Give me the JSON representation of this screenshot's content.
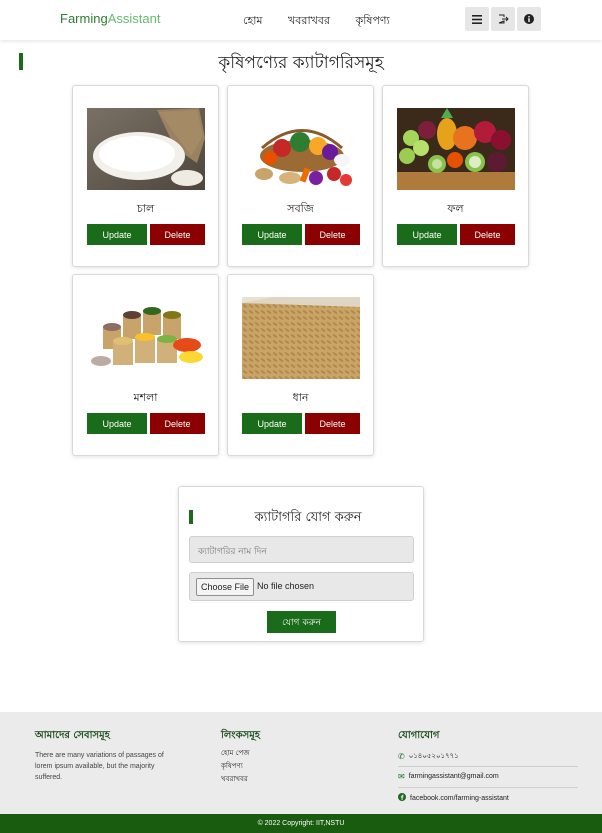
{
  "brand": {
    "part1": "Farming",
    "part2": "Assistant"
  },
  "nav": {
    "links": [
      "হোম",
      "খবরাখবর",
      "কৃষিপণ্য"
    ]
  },
  "nav_icons": [
    "menu-icon",
    "logout-icon",
    "info-icon"
  ],
  "section": {
    "title": "কৃষিপণ্যের ক্যাটাগরিসমূহ"
  },
  "categories": [
    {
      "name": "চাল",
      "image": "rice-image",
      "update_label": "Update",
      "delete_label": "Delete"
    },
    {
      "name": "সবজি",
      "image": "vegetables-image",
      "update_label": "Update",
      "delete_label": "Delete"
    },
    {
      "name": "ফল",
      "image": "fruits-image",
      "update_label": "Update",
      "delete_label": "Delete"
    },
    {
      "name": "মশলা",
      "image": "spices-image",
      "update_label": "Update",
      "delete_label": "Delete"
    },
    {
      "name": "ধান",
      "image": "paddy-image",
      "update_label": "Update",
      "delete_label": "Delete"
    }
  ],
  "add_form": {
    "title": "ক্যাটাগরি যোগ করুন",
    "input_placeholder": "ক্যাটাগরির নাম দিন",
    "file_button": "Choose File",
    "file_status": "No file chosen",
    "submit_label": "যোগ করুন"
  },
  "footer": {
    "services": {
      "heading": "আমাদের সেবাসমূহ",
      "text": "There are many variations of passages of lorem ipsum available, but the majority suffered."
    },
    "links": {
      "heading": "লিংকসমূহ",
      "items": [
        "হোম পেজ",
        "কৃষিপণ্য",
        "খবরাখবর"
      ]
    },
    "contact": {
      "heading": "যোগাযোগ",
      "phone": "০১৪০৫২০১৭৭১",
      "email": "farmingassistant@gmail.com",
      "facebook": "facebook.com/farming-assistant"
    },
    "copyright": "© 2022 Copyright: IIT,NSTU"
  },
  "colors": {
    "primary_green": "#1a6b1a",
    "delete_red": "#8b0000",
    "footer_bg": "#ebebeb",
    "copyright_bg": "#1a5c0f"
  }
}
